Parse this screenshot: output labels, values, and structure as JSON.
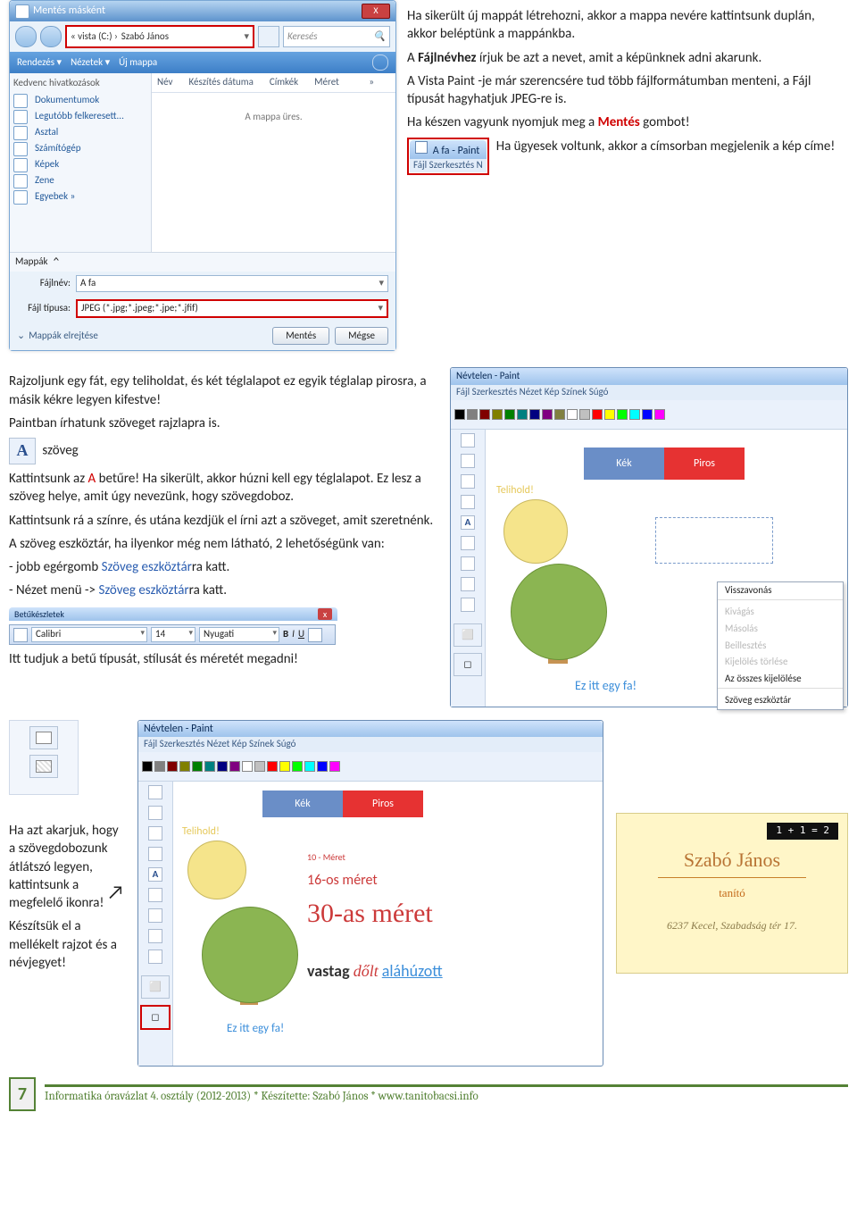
{
  "save_dialog": {
    "title": "Mentés másként",
    "path_prefix": "« vista (C:)  ›",
    "path": "Szabó János",
    "search_placeholder": "Keresés",
    "toolbar": {
      "organize": "Rendezés ▾",
      "views": "Nézetek ▾",
      "newfolder": "Új mappa"
    },
    "sidebar_header": "Kedvenc hivatkozások",
    "sidebar_items": [
      "Dokumentumok",
      "Legutóbb felkeresett...",
      "Asztal",
      "Számítógép",
      "Képek",
      "Zene",
      "Egyebek »"
    ],
    "columns": [
      "Név",
      "Készítés dátuma",
      "Címkék",
      "Méret"
    ],
    "empty_text": "A mappa üres.",
    "folders_label": "Mappák",
    "filename_label": "Fájlnév:",
    "filename_value": "A fa",
    "filetype_label": "Fájl típusa:",
    "filetype_value": "JPEG (*.jpg;*.jpeg;*.jpe;*.jfif)",
    "hide_folders": "Mappák elrejtése",
    "save_btn": "Mentés",
    "cancel_btn": "Mégse"
  },
  "para1": {
    "t1": "Ha sikerült új mappát létrehozni, akkor a mappa nevére kattintsunk duplán, akkor beléptünk a mappánkba.",
    "t2a": "A ",
    "bold": "Fájlnévhez",
    "t2b": " írjuk be azt a nevet, amit a képünknek adni akarunk.",
    "t3": "A Vista Paint -je már szerencsére tud több fájlformátumban menteni, a Fájl típusát hagyhatjuk JPEG-re is.",
    "t4a": "Ha készen vagyunk nyomjuk meg a ",
    "t4red": "Mentés",
    "t4b": " gombot!",
    "t5": "Ha ügyesek voltunk, akkor a címsorban megjelenik a kép címe!",
    "mini_title": "A fa - Paint",
    "mini_menu": "Fájl   Szerkesztés   N"
  },
  "sec2": {
    "p1": "Rajzoljunk egy fát, egy teliholdat, és két téglalapot ez egyik téglalap pirosra, a másik kékre legyen kifestve!",
    "p2": "Paintban írhatunk szöveget rajzlapra is.",
    "szoveg": "szöveg",
    "p3a": "Kattintsunk az ",
    "p3red": "A",
    "p3b": " betűre! Ha sikerült, akkor húzni kell egy téglalapot. Ez lesz a szöveg helye, amit úgy nevezünk, hogy szövegdoboz.",
    "p4": "Kattintsunk rá a színre, és utána kezdjük el írni azt a szöveget, amit szeretnénk.",
    "p5": "A szöveg eszköztár, ha ilyenkor még nem látható, 2 lehetőségünk van:",
    "p5a": "- jobb egérgomb ",
    "p5blue1": "Szöveg eszköztár",
    "p5a2": "ra katt.",
    "p5b": "- Nézet menü -> ",
    "p5blue2": "Szöveg eszköztár",
    "p5b2": "ra katt.",
    "p6": "Itt tudjuk a betű típusát, stílusát és méretét megadni!"
  },
  "font_toolbar": {
    "title": "Betűkészletek",
    "font": "Calibri",
    "size": "14",
    "script": "Nyugati",
    "b": "B",
    "i": "I",
    "u": "U"
  },
  "paint1": {
    "title": "Névtelen - Paint",
    "menu": "Fájl  Szerkesztés  Nézet  Kép  Színek  Súgó",
    "kek": "Kék",
    "piros": "Piros",
    "telihold": "Telihold!",
    "caption": "Ez itt egy fa!",
    "ctx": [
      "Visszavonás",
      "Kivágás",
      "Másolás",
      "Beillesztés",
      "Kijelölés törlése",
      "Az összes kijelölése",
      "Szöveg eszköztár"
    ]
  },
  "sec3": {
    "p1": "Ha azt akarjuk, hogy a szövegdobozunk átlátszó legyen, kattintsunk a megfelelő ikonra!",
    "p2": "Készítsük el a mellékelt rajzot és a névjegyet!"
  },
  "paint2": {
    "title": "Névtelen - Paint",
    "menu": "Fájl  Szerkesztés  Nézet  Kép  Színek  Súgó",
    "kek": "Kék",
    "piros": "Piros",
    "telihold": "Telihold!",
    "s10": "10 - Méret",
    "s16": "16-os méret",
    "s30": "30-as méret",
    "vastag": "vastag",
    "dolt": "dőlt",
    "alahuz": "aláhúzott",
    "caption": "Ez itt egy fa!"
  },
  "card": {
    "eq": "1 + 1 = 2",
    "name": "Szabó János",
    "role": "tanító",
    "addr": "6237 Kecel, Szabadság tér 17."
  },
  "footer": {
    "page": "7",
    "text": "Informatika óravázlat 4. osztály (2012-2013) * Készítette: Szabó János * www.tanitobacsi.info"
  }
}
